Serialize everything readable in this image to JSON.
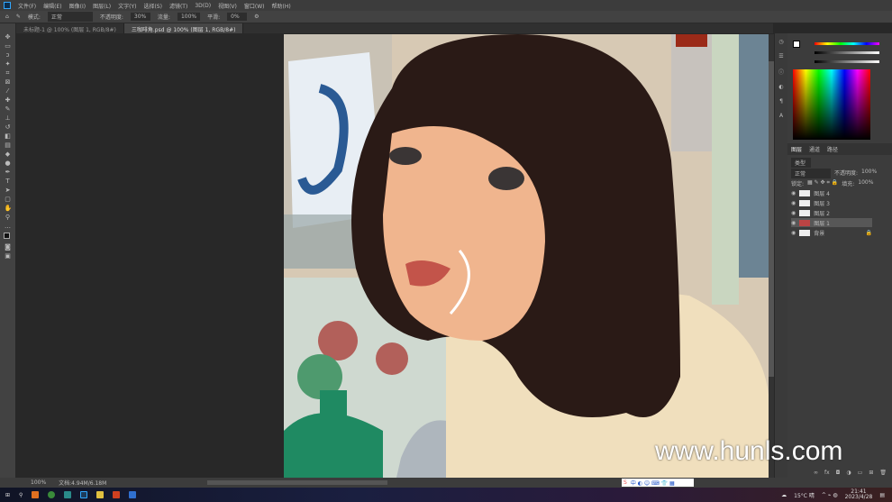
{
  "menu": [
    "文件(F)",
    "编辑(E)",
    "图像(I)",
    "图层(L)",
    "文字(Y)",
    "选择(S)",
    "滤镜(T)",
    "3D(D)",
    "视图(V)",
    "窗口(W)",
    "帮助(H)"
  ],
  "options": {
    "mode_label": "模式:",
    "mode": "正常",
    "opacity_label": "不透明度:",
    "opacity": "30%",
    "flow_label": "流量:",
    "flow": "100%",
    "smooth_label": "平滑:",
    "smooth": "0%"
  },
  "tabs": [
    "未标题-1 @ 100% (图层 1, RGB/8#)",
    "三咖啡角.psd @ 100% (图层 1, RGB/8#)"
  ],
  "panel": {
    "tabs": [
      "图层",
      "通道",
      "路径"
    ],
    "kind": "类型",
    "blend": "正常",
    "opacity_label": "不透明度:",
    "opacity": "100%",
    "lock_label": "锁定:",
    "fill_label": "填充:",
    "fill": "100%",
    "layers": [
      "图层 4",
      "图层 3",
      "图层 2",
      "图层 1",
      "背景"
    ]
  },
  "status": {
    "zoom": "100%",
    "doc": "文档:4.94M/6.18M"
  },
  "taskbar": {
    "weather": "15°C 晴",
    "time": "21:41",
    "date": "2023/4/28"
  },
  "watermark": "www.hunls.com"
}
